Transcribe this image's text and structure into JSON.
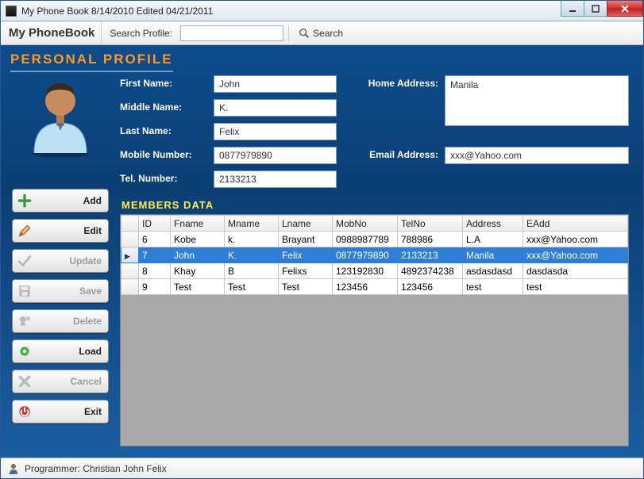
{
  "window": {
    "title": "My Phone Book 8/14/2010 Edited 04/21/2011"
  },
  "toolbar": {
    "brand": "My PhoneBook",
    "search_label": "Search Profile:",
    "search_value": "",
    "search_button": "Search"
  },
  "heading": "PERSONAL PROFILE",
  "form": {
    "first_name_label": "First Name:",
    "first_name": "John",
    "middle_name_label": "Middle Name:",
    "middle_name": "K.",
    "last_name_label": "Last Name:",
    "last_name": "Felix",
    "mobile_label": "Mobile Number:",
    "mobile": "0877979890",
    "tel_label": "Tel. Number:",
    "tel": "2133213",
    "home_address_label": "Home Address:",
    "home_address": "Manila",
    "email_label": "Email Address:",
    "email": "xxx@Yahoo.com"
  },
  "members_heading": "MEMBERS DATA",
  "grid": {
    "columns": [
      "ID",
      "Fname",
      "Mname",
      "Lname",
      "MobNo",
      "TelNo",
      "Address",
      "EAdd"
    ],
    "rows": [
      {
        "id": "6",
        "fname": "Kobe",
        "mname": "k.",
        "lname": "Brayant",
        "mob": "0988987789",
        "tel": "788986",
        "addr": "L.A",
        "eadd": "xxx@Yahoo.com",
        "selected": false
      },
      {
        "id": "7",
        "fname": "John",
        "mname": "K.",
        "lname": "Felix",
        "mob": "0877979890",
        "tel": "2133213",
        "addr": "Manila",
        "eadd": "xxx@Yahoo.com",
        "selected": true
      },
      {
        "id": "8",
        "fname": "Khay",
        "mname": "B",
        "lname": "Felixs",
        "mob": "123192830",
        "tel": "4892374238",
        "addr": "asdasdasd",
        "eadd": "dasdasda",
        "selected": false
      },
      {
        "id": "9",
        "fname": "Test",
        "mname": "Test",
        "lname": "Test",
        "mob": "123456",
        "tel": "123456",
        "addr": "test",
        "eadd": "test",
        "selected": false
      }
    ]
  },
  "buttons": {
    "add": "Add",
    "edit": "Edit",
    "update": "Update",
    "save": "Save",
    "delete": "Delete",
    "load": "Load",
    "cancel": "Cancel",
    "exit": "Exit"
  },
  "statusbar": {
    "text": "Programmer: Christian John Felix"
  }
}
